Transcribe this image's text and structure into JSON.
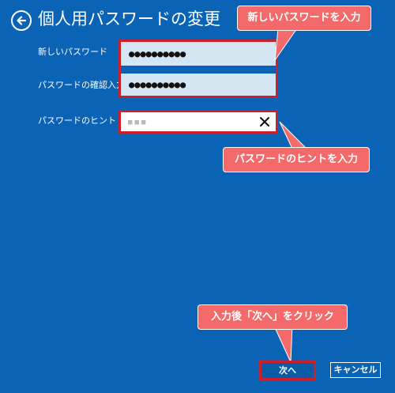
{
  "header": {
    "back_icon": "arrow-left-circle-icon",
    "title": "個人用パスワードの変更"
  },
  "form": {
    "new_password": {
      "label": "新しいパスワード",
      "value": "●●●●●●●●●●"
    },
    "confirm_password": {
      "label": "パスワードの確認入力",
      "value": "●●●●●●●●●●"
    },
    "hint": {
      "label": "パスワードのヒント",
      "value": "▪▪▪",
      "clear_icon": "close-icon"
    }
  },
  "callouts": {
    "password": "新しいパスワードを入力",
    "hint": "パスワードのヒントを入力",
    "next": "入力後「次へ」をクリック"
  },
  "buttons": {
    "next": "次へ",
    "cancel": "キャンセル"
  },
  "colors": {
    "background": "#0a63b4",
    "callout": "#f46a6a",
    "highlight": "#cc1f2b"
  }
}
